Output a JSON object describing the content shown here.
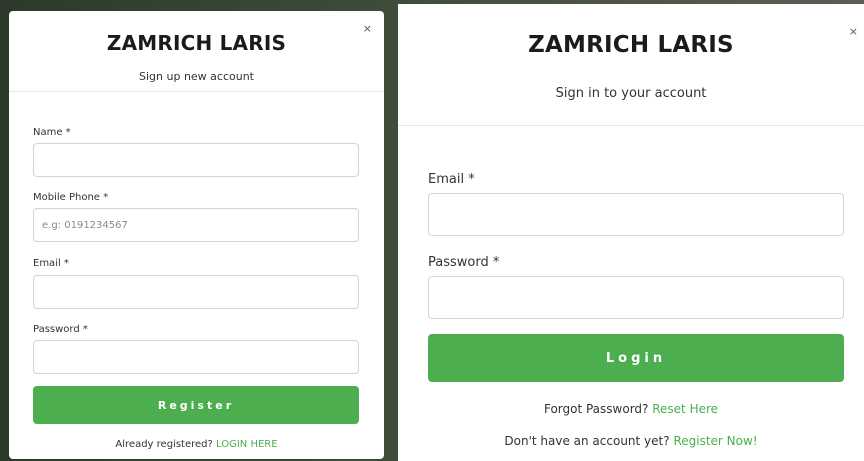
{
  "signup": {
    "close_symbol": "×",
    "title": "ZAMRICH LARIS",
    "subtitle": "Sign up new account",
    "fields": [
      {
        "label": "Name *",
        "placeholder": "",
        "value": ""
      },
      {
        "label": "Mobile Phone *",
        "placeholder": "e.g: 0191234567",
        "value": ""
      },
      {
        "label": "Email *",
        "placeholder": "",
        "value": ""
      },
      {
        "label": "Password *",
        "placeholder": "",
        "value": ""
      }
    ],
    "button_label": "Register",
    "footer_text": "Already registered?",
    "footer_link": "LOGIN HERE"
  },
  "signin": {
    "close_symbol": "×",
    "title": "ZAMRICH LARIS",
    "subtitle": "Sign in to your account",
    "fields": [
      {
        "label": "Email *",
        "placeholder": "",
        "value": ""
      },
      {
        "label": "Password *",
        "placeholder": "",
        "value": ""
      }
    ],
    "button_label": "Login",
    "forgot_text": "Forgot Password?",
    "forgot_link": "Reset Here",
    "register_text": "Don't have an account yet?",
    "register_link": "Register Now!"
  },
  "colors": {
    "accent": "#4cae4f",
    "title": "#1b1b1b",
    "border": "#ced4da"
  }
}
